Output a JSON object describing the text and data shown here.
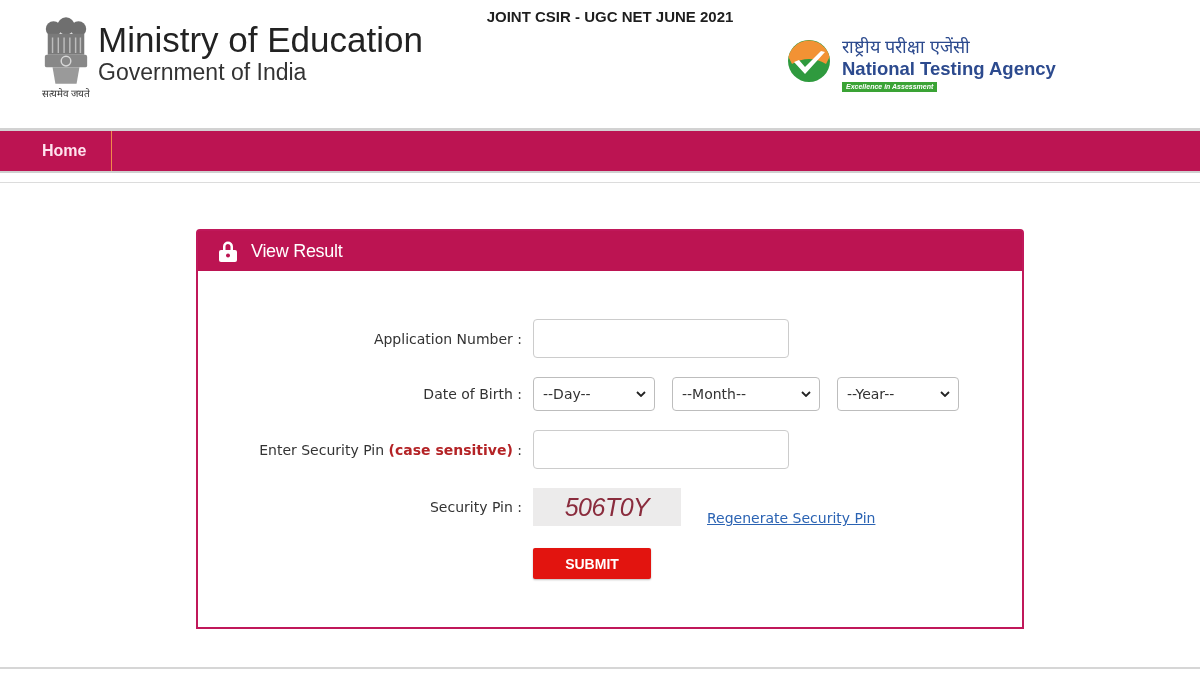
{
  "header": {
    "ministry": {
      "motto": "सत्यमेव जयते",
      "name": "Ministry of Education",
      "subtitle": "Government of India"
    },
    "title": "JOINT CSIR - UGC NET JUNE 2021",
    "agency": {
      "name_hindi": "राष्ट्रीय परीक्षा एजेंसी",
      "name": "National Testing Agency",
      "tagline": "Excellence in Assessment"
    }
  },
  "nav": {
    "items": [
      {
        "label": "Home"
      }
    ]
  },
  "panel": {
    "title": "View Result",
    "fields": [
      {
        "kind": "text",
        "label": "Application Number :"
      },
      {
        "kind": "date",
        "label": "Date of Birth :",
        "selects": [
          {
            "value": "--Day--"
          },
          {
            "value": "--Month--"
          },
          {
            "value": "--Year--"
          }
        ]
      },
      {
        "kind": "text",
        "label": "Enter Security Pin **(case sensitive)** :"
      },
      {
        "kind": "captcha",
        "label": "Security Pin :",
        "captcha": "506T0Y",
        "link": "Regenerate Security Pin"
      }
    ],
    "submit": "SUBMIT"
  }
}
